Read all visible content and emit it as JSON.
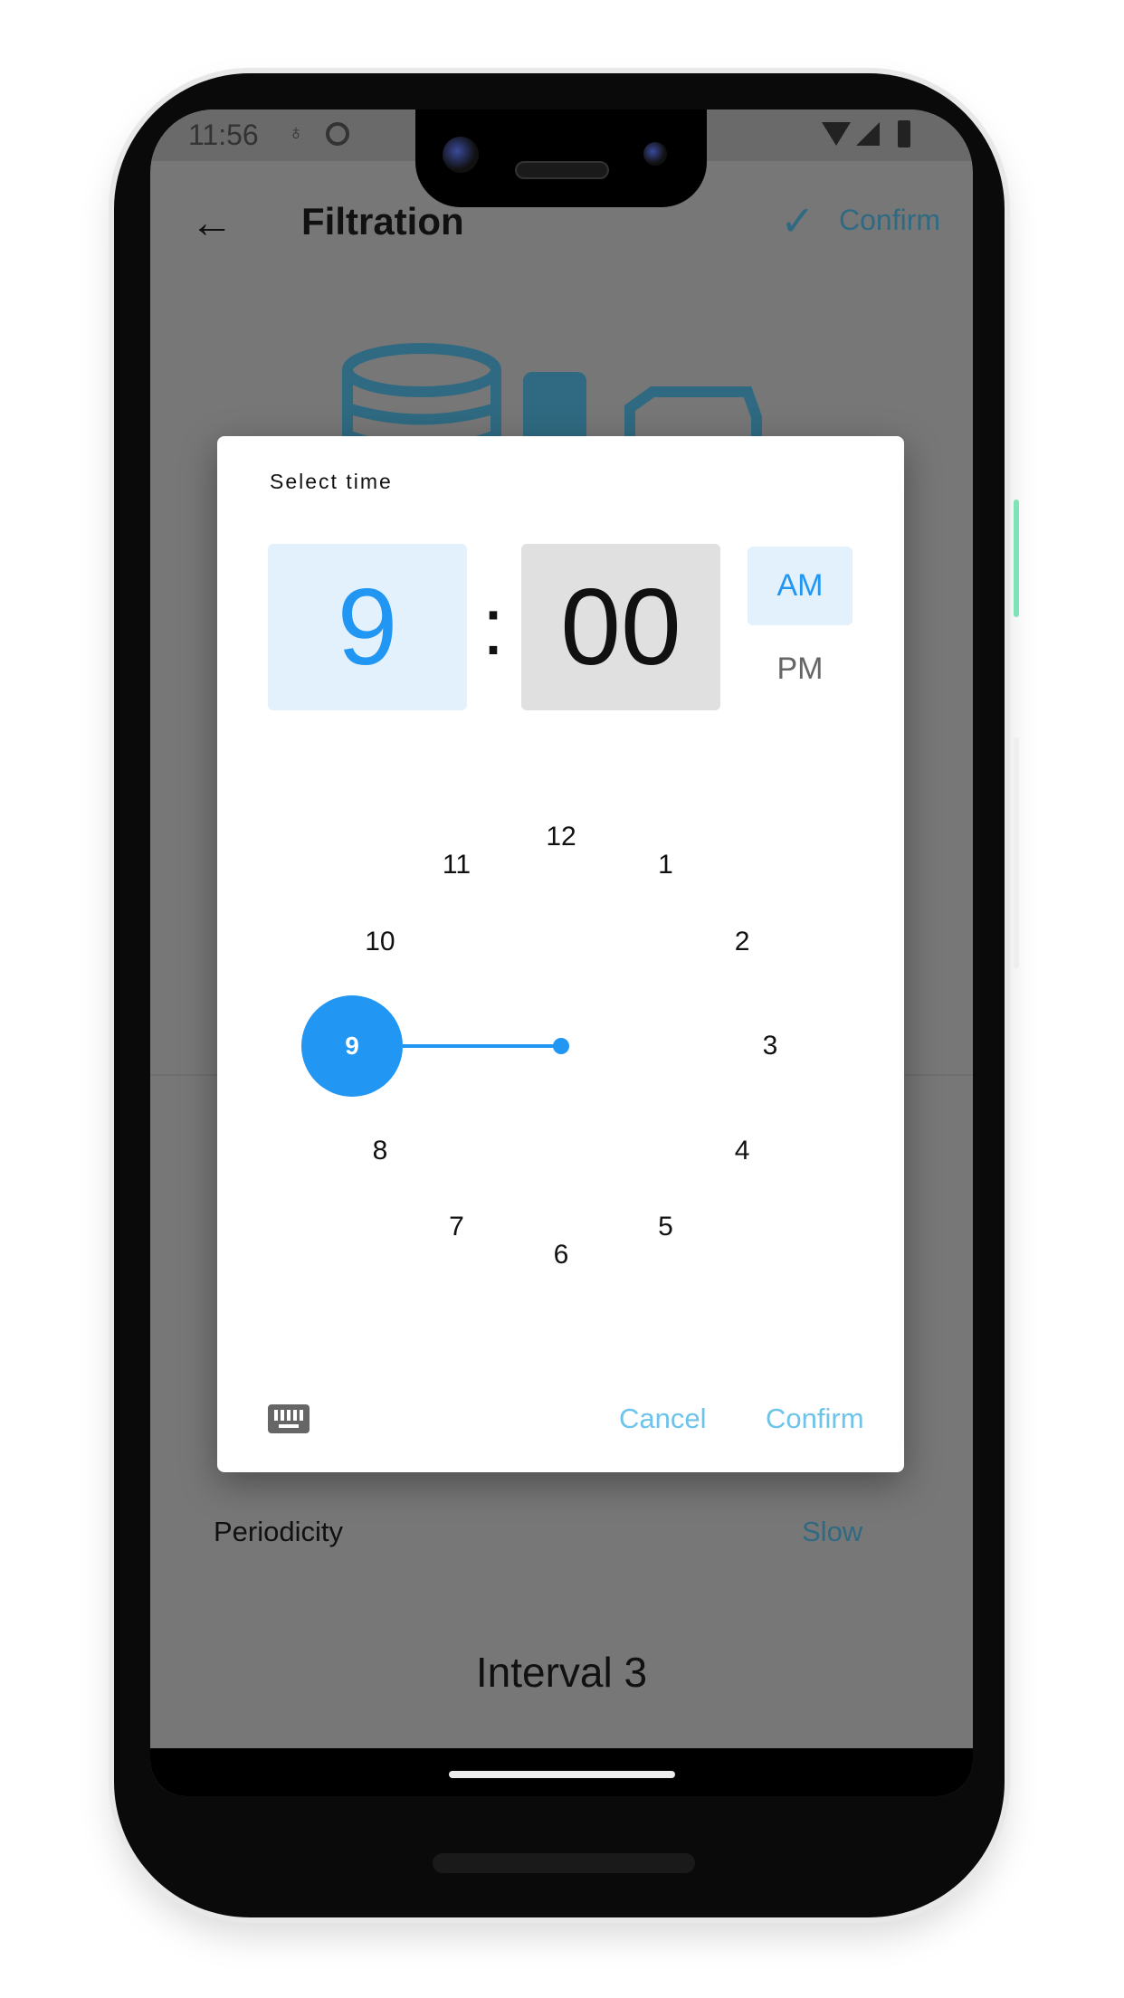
{
  "status_bar": {
    "time": "11:56"
  },
  "header": {
    "title": "Filtration",
    "confirm_label": "Confirm"
  },
  "background": {
    "periodicity_label": "Periodicity",
    "periodicity_value": "Slow",
    "interval_title": "Interval 3"
  },
  "dialog": {
    "title": "Select time",
    "hour": "9",
    "separator": ":",
    "minute": "00",
    "am_label": "AM",
    "pm_label": "PM",
    "selected_period": "AM",
    "clock_numbers": [
      "12",
      "1",
      "2",
      "3",
      "4",
      "5",
      "6",
      "7",
      "8",
      "9",
      "10",
      "11"
    ],
    "selected_hour": "9",
    "cancel_label": "Cancel",
    "confirm_label": "Confirm"
  },
  "colors": {
    "accent": "#2196f3",
    "accent_light": "#e3f1fd",
    "button_text": "#6ec3ea",
    "scrim": "#777777",
    "muted_teal": "#2f6a82"
  }
}
